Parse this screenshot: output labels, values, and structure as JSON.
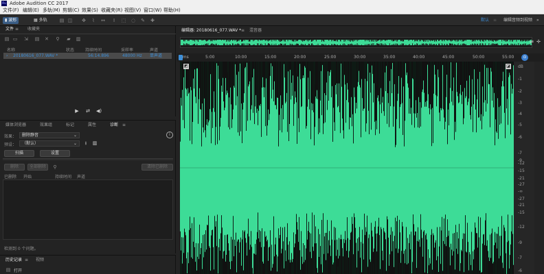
{
  "app": {
    "title": "Adobe Audition CC 2017",
    "logo": "Au"
  },
  "menu": [
    "文件(F)",
    "编辑(E)",
    "多轨(M)",
    "剪辑(C)",
    "效果(S)",
    "收藏夹(R)",
    "视图(V)",
    "窗口(W)",
    "帮助(H)"
  ],
  "toolbar": {
    "waveform": "波形",
    "multitrack": "多轨",
    "workspace_default": "默认",
    "workspace_edit": "编辑音频到视频",
    "workspace_more": "»"
  },
  "files_panel": {
    "tab_files": "文件",
    "tab_favorites": "收藏夹",
    "columns": {
      "name": "名称",
      "status": "状态",
      "duration": "持续时间",
      "sample_rate": "采样率",
      "channels": "声道"
    },
    "file": {
      "name": "20180616_077.WAV *",
      "duration": "56:14.896",
      "sample_rate": "48000 Hz",
      "channels": "单声道"
    }
  },
  "diag_panel": {
    "tabs": [
      "媒体浏览器",
      "效果组",
      "标记",
      "属性",
      "诊断"
    ],
    "effect_label": "效果：",
    "effect_value": "删除静音",
    "preset_label": "预设：",
    "preset_value": "（默认）",
    "scan_button": "扫描",
    "settings_button": "设置",
    "delete_button": "删除",
    "delete_all_button": "全部删除",
    "clear_button": "清除已删除",
    "cols": {
      "deleted": "已删除",
      "start": "开始",
      "duration": "持续时间",
      "channel": "声道"
    },
    "status": "检测到 0 个问题。"
  },
  "history_panel": {
    "tab_history": "历史记录",
    "tab_video": "视频",
    "item": "打开"
  },
  "editor": {
    "tab_editor": "编辑器: 20180616_077.WAV *",
    "tab_mixer": "混音器",
    "ruler_unit": "hms",
    "ruler_ticks": [
      "5:00",
      "10:00",
      "15:00",
      "20:00",
      "25:00",
      "30:00",
      "35:00",
      "40:00",
      "45:00",
      "50:00",
      "55:00"
    ],
    "db_unit": "dB",
    "db_labels_top": [
      "-1",
      "-2",
      "-3",
      "-4",
      "-5",
      "-6",
      "-7",
      "-9",
      "-12",
      "-15",
      "-21",
      "-27",
      "-∞"
    ],
    "db_labels_bottom": [
      "-27",
      "-21",
      "-15",
      "-12",
      "-9",
      "-7",
      "-6",
      "-5",
      "-4",
      "-3",
      "-2"
    ]
  },
  "colors": {
    "waveform": "#3ddc97",
    "selection": "#3b5e86",
    "accent": "#3d8ed7"
  }
}
